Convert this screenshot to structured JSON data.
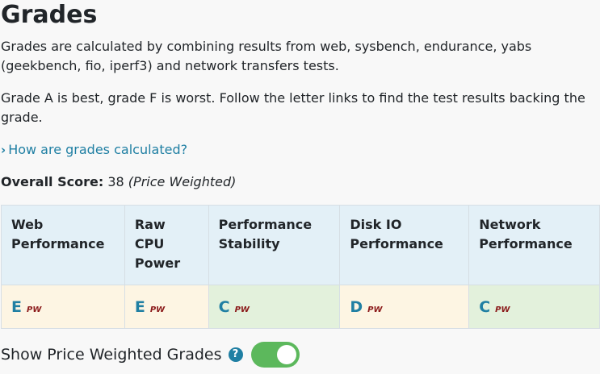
{
  "page": {
    "title": "Grades",
    "intro": "Grades are calculated by combining results from web, sysbench, endurance, yabs (geekbench, fio, iperf3) and network transfers tests.",
    "note": "Grade A is best, grade F is worst. Follow the letter links to find the test results backing the grade.",
    "how_link": "How are grades calculated?",
    "overall_label": "Overall Score:",
    "overall_value": "38",
    "overall_suffix": "(Price Weighted)"
  },
  "table": {
    "headers": [
      "Web Performance",
      "Raw CPU Power",
      "Performance Stability",
      "Disk IO Performance",
      "Network Performance"
    ],
    "grades": [
      {
        "letter": "E",
        "tag": "PW",
        "status": "warn"
      },
      {
        "letter": "E",
        "tag": "PW",
        "status": "warn"
      },
      {
        "letter": "C",
        "tag": "PW",
        "status": "ok"
      },
      {
        "letter": "D",
        "tag": "PW",
        "status": "warn"
      },
      {
        "letter": "C",
        "tag": "PW",
        "status": "ok"
      }
    ]
  },
  "toggle": {
    "label": "Show Price Weighted Grades",
    "help_icon": "?",
    "state": "on"
  },
  "colors": {
    "link": "#1f7fa3",
    "header_bg": "#e3f0f7",
    "warn_bg": "#fdf5e3",
    "ok_bg": "#e3f1dc",
    "toggle_on": "#5cb85c",
    "pw_tag": "#8b1a1a"
  },
  "icons": {
    "how_link": "chevron-right-icon",
    "help": "question-circle-icon"
  }
}
